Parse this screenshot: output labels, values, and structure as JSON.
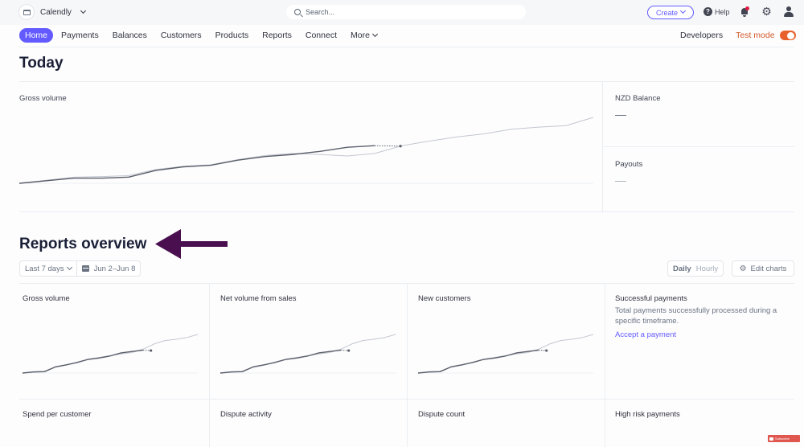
{
  "topbar": {
    "account_name": "Calendly",
    "search_placeholder": "Search...",
    "create_label": "Create",
    "help_label": "Help",
    "icons": [
      "store-icon",
      "search-icon",
      "help-icon",
      "bell-icon",
      "gear-icon",
      "user-icon"
    ]
  },
  "nav": {
    "items": [
      {
        "label": "Home",
        "active": true
      },
      {
        "label": "Payments"
      },
      {
        "label": "Balances"
      },
      {
        "label": "Customers"
      },
      {
        "label": "Products"
      },
      {
        "label": "Reports"
      },
      {
        "label": "Connect"
      },
      {
        "label": "More"
      }
    ],
    "developers_label": "Developers",
    "test_mode_label": "Test mode",
    "test_mode_on": true
  },
  "today": {
    "title": "Today",
    "gross_volume_label": "Gross volume",
    "nzd_balance_label": "NZD Balance",
    "nzd_balance_value": "—",
    "payouts_label": "Payouts",
    "payouts_value": "—"
  },
  "reports": {
    "title": "Reports overview",
    "range_label": "Last 7 days",
    "date_range": "Jun 2–Jun 8",
    "daily_label": "Daily",
    "hourly_label": "Hourly",
    "edit_charts_label": "Edit charts",
    "cards": [
      {
        "title": "Gross volume"
      },
      {
        "title": "Net volume from sales"
      },
      {
        "title": "New customers"
      },
      {
        "title": "Successful payments",
        "description": "Total payments successfully processed during a specific timeframe.",
        "link": "Accept a payment"
      },
      {
        "title": "Spend per customer"
      },
      {
        "title": "Dispute activity"
      },
      {
        "title": "Dispute count"
      },
      {
        "title": "High risk payments"
      }
    ]
  },
  "colors": {
    "accent": "#635bff",
    "test_mode": "#e8612c",
    "annotation_arrow": "#4a0f4f"
  },
  "sparklines": {
    "today_current": [
      0,
      0.5,
      1,
      1,
      1.2,
      2.5,
      3.2,
      3.5,
      4.5,
      5.2,
      5.6,
      6.2,
      7,
      7.3
    ],
    "today_previous": [
      0,
      0.6,
      1.2,
      1.3,
      1.5,
      2.7,
      3.3,
      3.6,
      4.6,
      5.4,
      5.8,
      5.6,
      5.3,
      5.8,
      7.3,
      8.2,
      9,
      9.6,
      10.5,
      10.9,
      11.2,
      12.8
    ],
    "card_current": [
      0,
      0.3,
      0.4,
      1.8,
      2.4,
      3.1,
      4.0,
      4.4,
      5.0,
      5.9,
      6.3,
      6.7
    ],
    "card_previous": [
      0,
      0.4,
      0.5,
      1.7,
      2.3,
      3.2,
      4.1,
      4.6,
      5.1,
      5.6,
      6.0,
      7.0,
      8.5,
      9.5,
      9.9,
      10.4,
      11.3
    ]
  }
}
